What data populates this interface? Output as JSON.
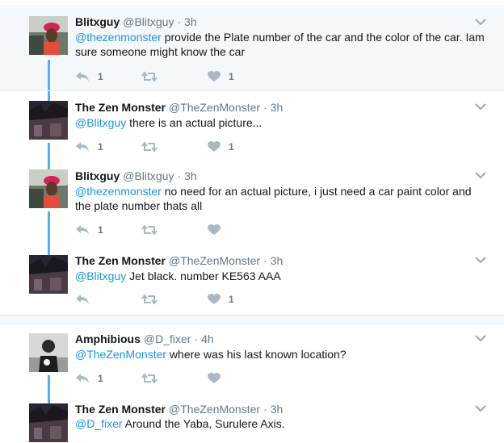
{
  "colors": {
    "link": "#1b95e0",
    "thread_line": "#4ab3f4",
    "meta": "#657786",
    "highlight_bg": "#f5f8fa"
  },
  "icons": {
    "reply": "reply-icon",
    "retweet": "retweet-icon",
    "like": "heart-icon",
    "more": "chevron-down-icon"
  },
  "tweets": [
    {
      "name": "Blitxguy",
      "handle": "@Blitxguy",
      "separator": "·",
      "time": "3h",
      "mention": "@thezenmonster",
      "body": " provide the Plate number of the car and the color of the car. Iam sure someone might know the car",
      "replies": "1",
      "retweets": "",
      "likes": "1"
    },
    {
      "name": "The Zen Monster",
      "handle": "@TheZenMonster",
      "separator": "·",
      "time": "3h",
      "mention": "@Blitxguy",
      "body": " there is an actual picture...",
      "replies": "1",
      "retweets": "",
      "likes": "1"
    },
    {
      "name": "Blitxguy",
      "handle": "@Blitxguy",
      "separator": "·",
      "time": "3h",
      "mention": "@thezenmonster",
      "body": " no need for an actual picture, i just need a car paint color and the plate number thats all",
      "replies": "1",
      "retweets": "",
      "likes": ""
    },
    {
      "name": "The Zen Monster",
      "handle": "@TheZenMonster",
      "separator": "·",
      "time": "3h",
      "mention": "@Blitxguy",
      "body": "  Jet black. number KE563 AAA",
      "replies": "",
      "retweets": "",
      "likes": "1"
    },
    {
      "name": "Amphibious",
      "handle": "@D_fixer",
      "separator": "·",
      "time": "4h",
      "mention": "@TheZenMonster",
      "body": " where was his last known location?",
      "replies": "1",
      "retweets": "",
      "likes": ""
    },
    {
      "name": "The Zen Monster",
      "handle": "@TheZenMonster",
      "separator": "·",
      "time": "3h",
      "mention": "@D_fixer",
      "body": "  Around the Yaba, Surulere Axis.",
      "replies": "",
      "retweets": "",
      "likes": ""
    }
  ]
}
